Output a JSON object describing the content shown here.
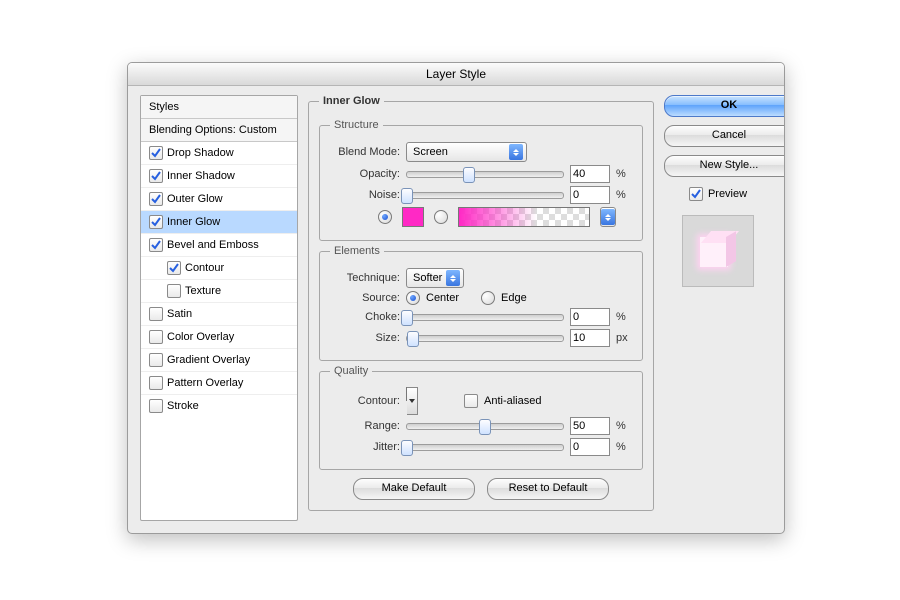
{
  "window": {
    "title": "Layer Style"
  },
  "sidebar": {
    "header_styles": "Styles",
    "header_blend": "Blending Options: Custom",
    "items": [
      {
        "label": "Drop Shadow",
        "checked": true,
        "selected": false,
        "sub": false
      },
      {
        "label": "Inner Shadow",
        "checked": true,
        "selected": false,
        "sub": false
      },
      {
        "label": "Outer Glow",
        "checked": true,
        "selected": false,
        "sub": false
      },
      {
        "label": "Inner Glow",
        "checked": true,
        "selected": true,
        "sub": false
      },
      {
        "label": "Bevel and Emboss",
        "checked": true,
        "selected": false,
        "sub": false
      },
      {
        "label": "Contour",
        "checked": true,
        "selected": false,
        "sub": true
      },
      {
        "label": "Texture",
        "checked": false,
        "selected": false,
        "sub": true
      },
      {
        "label": "Satin",
        "checked": false,
        "selected": false,
        "sub": false
      },
      {
        "label": "Color Overlay",
        "checked": false,
        "selected": false,
        "sub": false
      },
      {
        "label": "Gradient Overlay",
        "checked": false,
        "selected": false,
        "sub": false
      },
      {
        "label": "Pattern Overlay",
        "checked": false,
        "selected": false,
        "sub": false
      },
      {
        "label": "Stroke",
        "checked": false,
        "selected": false,
        "sub": false
      }
    ]
  },
  "main": {
    "title": "Inner Glow",
    "structure": {
      "legend": "Structure",
      "blend_mode_label": "Blend Mode:",
      "blend_mode_value": "Screen",
      "opacity_label": "Opacity:",
      "opacity_value": "40",
      "opacity_unit": "%",
      "opacity_pct": 40,
      "noise_label": "Noise:",
      "noise_value": "0",
      "noise_unit": "%",
      "noise_pct": 0,
      "color_selected": true,
      "color_hex": "#ff29c5"
    },
    "elements": {
      "legend": "Elements",
      "technique_label": "Technique:",
      "technique_value": "Softer",
      "source_label": "Source:",
      "source_center": "Center",
      "source_edge": "Edge",
      "source_value": "center",
      "choke_label": "Choke:",
      "choke_value": "0",
      "choke_unit": "%",
      "choke_pct": 0,
      "size_label": "Size:",
      "size_value": "10",
      "size_unit": "px",
      "size_pct": 4
    },
    "quality": {
      "legend": "Quality",
      "contour_label": "Contour:",
      "antialias_label": "Anti-aliased",
      "antialias_checked": false,
      "range_label": "Range:",
      "range_value": "50",
      "range_unit": "%",
      "range_pct": 50,
      "jitter_label": "Jitter:",
      "jitter_value": "0",
      "jitter_unit": "%",
      "jitter_pct": 0
    },
    "buttons": {
      "make_default": "Make Default",
      "reset_default": "Reset to Default"
    }
  },
  "right": {
    "ok": "OK",
    "cancel": "Cancel",
    "new_style": "New Style...",
    "preview_label": "Preview",
    "preview_checked": true
  }
}
